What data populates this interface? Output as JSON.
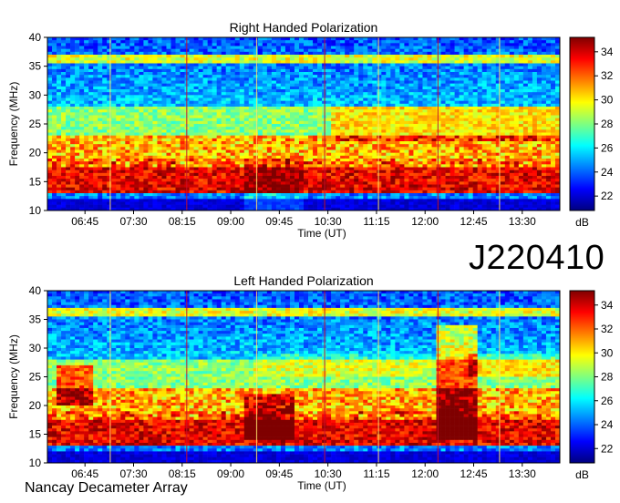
{
  "observation_id": "J220410",
  "instrument": "Nancay Decameter Array",
  "colorscale": {
    "stops": [
      "#00007f",
      "#0000ff",
      "#007fff",
      "#00ffff",
      "#7fff7f",
      "#ffff00",
      "#ff7f00",
      "#ff0000",
      "#7f0000"
    ]
  },
  "chart_data": [
    {
      "type": "heatmap",
      "title": "Right Handed Polarization",
      "xlabel": "Time (UT)",
      "ylabel": "Frequency (MHz)",
      "x_ticks": [
        "06:45",
        "07:30",
        "08:15",
        "09:00",
        "09:45",
        "10:30",
        "11:15",
        "12:00",
        "12:45",
        "13:30"
      ],
      "x_tick_hours": [
        6.75,
        7.5,
        8.25,
        9.0,
        9.75,
        10.5,
        11.25,
        12.0,
        12.75,
        13.5
      ],
      "xlim_hours": [
        6.17,
        14.08
      ],
      "ylim": [
        10,
        40
      ],
      "y_ticks": [
        10,
        15,
        20,
        25,
        30,
        35,
        40
      ],
      "colorbar": {
        "label": "dB",
        "ticks": [
          22,
          24,
          26,
          28,
          30,
          32,
          34
        ],
        "range": [
          20.8,
          35.2
        ]
      },
      "grid": false
    },
    {
      "type": "heatmap",
      "title": "Left Handed Polarization",
      "xlabel": "Time (UT)",
      "ylabel": "Frequency (MHz)",
      "x_ticks": [
        "06:45",
        "07:30",
        "08:15",
        "09:00",
        "09:45",
        "10:30",
        "11:15",
        "12:00",
        "12:45",
        "13:30"
      ],
      "x_tick_hours": [
        6.75,
        7.5,
        8.25,
        9.0,
        9.75,
        10.5,
        11.25,
        12.0,
        12.75,
        13.5
      ],
      "xlim_hours": [
        6.17,
        14.08
      ],
      "ylim": [
        10,
        40
      ],
      "y_ticks": [
        10,
        15,
        20,
        25,
        30,
        35,
        40
      ],
      "colorbar": {
        "label": "dB",
        "ticks": [
          22,
          24,
          26,
          28,
          30,
          32,
          34
        ],
        "range": [
          20.8,
          35.2
        ]
      },
      "grid": false
    }
  ]
}
